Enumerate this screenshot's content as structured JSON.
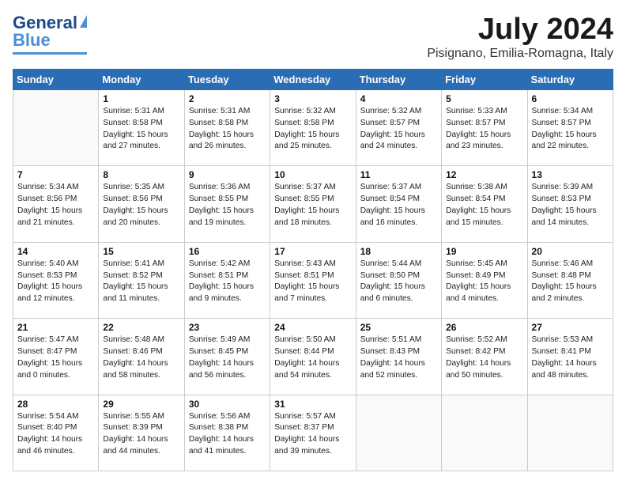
{
  "logo": {
    "line1": "General",
    "line2": "Blue"
  },
  "header": {
    "month": "July 2024",
    "location": "Pisignano, Emilia-Romagna, Italy"
  },
  "weekdays": [
    "Sunday",
    "Monday",
    "Tuesday",
    "Wednesday",
    "Thursday",
    "Friday",
    "Saturday"
  ],
  "weeks": [
    [
      {
        "day": "",
        "info": ""
      },
      {
        "day": "1",
        "info": "Sunrise: 5:31 AM\nSunset: 8:58 PM\nDaylight: 15 hours\nand 27 minutes."
      },
      {
        "day": "2",
        "info": "Sunrise: 5:31 AM\nSunset: 8:58 PM\nDaylight: 15 hours\nand 26 minutes."
      },
      {
        "day": "3",
        "info": "Sunrise: 5:32 AM\nSunset: 8:58 PM\nDaylight: 15 hours\nand 25 minutes."
      },
      {
        "day": "4",
        "info": "Sunrise: 5:32 AM\nSunset: 8:57 PM\nDaylight: 15 hours\nand 24 minutes."
      },
      {
        "day": "5",
        "info": "Sunrise: 5:33 AM\nSunset: 8:57 PM\nDaylight: 15 hours\nand 23 minutes."
      },
      {
        "day": "6",
        "info": "Sunrise: 5:34 AM\nSunset: 8:57 PM\nDaylight: 15 hours\nand 22 minutes."
      }
    ],
    [
      {
        "day": "7",
        "info": "Sunrise: 5:34 AM\nSunset: 8:56 PM\nDaylight: 15 hours\nand 21 minutes."
      },
      {
        "day": "8",
        "info": "Sunrise: 5:35 AM\nSunset: 8:56 PM\nDaylight: 15 hours\nand 20 minutes."
      },
      {
        "day": "9",
        "info": "Sunrise: 5:36 AM\nSunset: 8:55 PM\nDaylight: 15 hours\nand 19 minutes."
      },
      {
        "day": "10",
        "info": "Sunrise: 5:37 AM\nSunset: 8:55 PM\nDaylight: 15 hours\nand 18 minutes."
      },
      {
        "day": "11",
        "info": "Sunrise: 5:37 AM\nSunset: 8:54 PM\nDaylight: 15 hours\nand 16 minutes."
      },
      {
        "day": "12",
        "info": "Sunrise: 5:38 AM\nSunset: 8:54 PM\nDaylight: 15 hours\nand 15 minutes."
      },
      {
        "day": "13",
        "info": "Sunrise: 5:39 AM\nSunset: 8:53 PM\nDaylight: 15 hours\nand 14 minutes."
      }
    ],
    [
      {
        "day": "14",
        "info": "Sunrise: 5:40 AM\nSunset: 8:53 PM\nDaylight: 15 hours\nand 12 minutes."
      },
      {
        "day": "15",
        "info": "Sunrise: 5:41 AM\nSunset: 8:52 PM\nDaylight: 15 hours\nand 11 minutes."
      },
      {
        "day": "16",
        "info": "Sunrise: 5:42 AM\nSunset: 8:51 PM\nDaylight: 15 hours\nand 9 minutes."
      },
      {
        "day": "17",
        "info": "Sunrise: 5:43 AM\nSunset: 8:51 PM\nDaylight: 15 hours\nand 7 minutes."
      },
      {
        "day": "18",
        "info": "Sunrise: 5:44 AM\nSunset: 8:50 PM\nDaylight: 15 hours\nand 6 minutes."
      },
      {
        "day": "19",
        "info": "Sunrise: 5:45 AM\nSunset: 8:49 PM\nDaylight: 15 hours\nand 4 minutes."
      },
      {
        "day": "20",
        "info": "Sunrise: 5:46 AM\nSunset: 8:48 PM\nDaylight: 15 hours\nand 2 minutes."
      }
    ],
    [
      {
        "day": "21",
        "info": "Sunrise: 5:47 AM\nSunset: 8:47 PM\nDaylight: 15 hours\nand 0 minutes."
      },
      {
        "day": "22",
        "info": "Sunrise: 5:48 AM\nSunset: 8:46 PM\nDaylight: 14 hours\nand 58 minutes."
      },
      {
        "day": "23",
        "info": "Sunrise: 5:49 AM\nSunset: 8:45 PM\nDaylight: 14 hours\nand 56 minutes."
      },
      {
        "day": "24",
        "info": "Sunrise: 5:50 AM\nSunset: 8:44 PM\nDaylight: 14 hours\nand 54 minutes."
      },
      {
        "day": "25",
        "info": "Sunrise: 5:51 AM\nSunset: 8:43 PM\nDaylight: 14 hours\nand 52 minutes."
      },
      {
        "day": "26",
        "info": "Sunrise: 5:52 AM\nSunset: 8:42 PM\nDaylight: 14 hours\nand 50 minutes."
      },
      {
        "day": "27",
        "info": "Sunrise: 5:53 AM\nSunset: 8:41 PM\nDaylight: 14 hours\nand 48 minutes."
      }
    ],
    [
      {
        "day": "28",
        "info": "Sunrise: 5:54 AM\nSunset: 8:40 PM\nDaylight: 14 hours\nand 46 minutes."
      },
      {
        "day": "29",
        "info": "Sunrise: 5:55 AM\nSunset: 8:39 PM\nDaylight: 14 hours\nand 44 minutes."
      },
      {
        "day": "30",
        "info": "Sunrise: 5:56 AM\nSunset: 8:38 PM\nDaylight: 14 hours\nand 41 minutes."
      },
      {
        "day": "31",
        "info": "Sunrise: 5:57 AM\nSunset: 8:37 PM\nDaylight: 14 hours\nand 39 minutes."
      },
      {
        "day": "",
        "info": ""
      },
      {
        "day": "",
        "info": ""
      },
      {
        "day": "",
        "info": ""
      }
    ]
  ]
}
